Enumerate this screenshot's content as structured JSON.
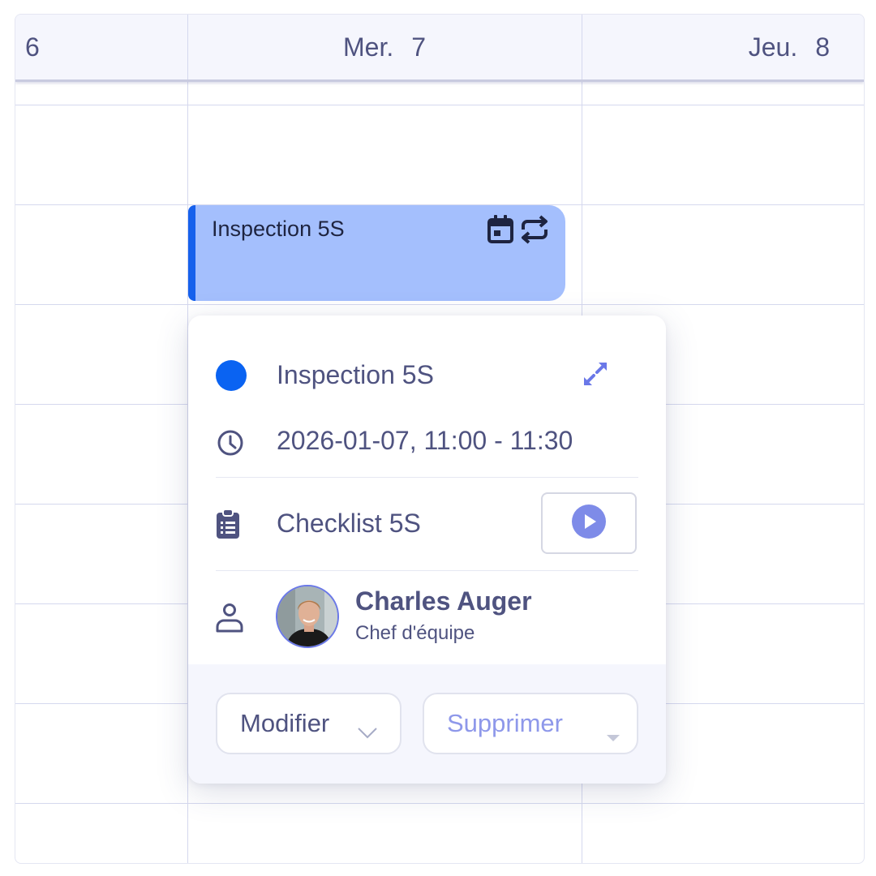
{
  "calendar": {
    "days": [
      {
        "weekday": "",
        "date": "6"
      },
      {
        "weekday": "Mer.",
        "date": "7"
      },
      {
        "weekday": "Jeu.",
        "date": "8"
      }
    ]
  },
  "event_block": {
    "title": "Inspection 5S",
    "icons": [
      "calendar-icon",
      "repeat-icon"
    ],
    "background": "#a4bffd",
    "accent": "#1661ec"
  },
  "popover": {
    "title": "Inspection 5S",
    "status_color": "#0a63f2",
    "datetime": "2026-01-07, 11:00 - 11:30",
    "checklist": "Checklist 5S",
    "assignee": {
      "name": "Charles Auger",
      "role": "Chef d'équipe"
    },
    "actions": {
      "modify_label": "Modifier",
      "delete_label": "Supprimer"
    },
    "icons": {
      "status": "status-dot-icon",
      "expand": "expand-icon",
      "time": "clock-icon",
      "checklist": "clipboard-list-icon",
      "start": "play-icon",
      "person": "user-icon"
    }
  }
}
